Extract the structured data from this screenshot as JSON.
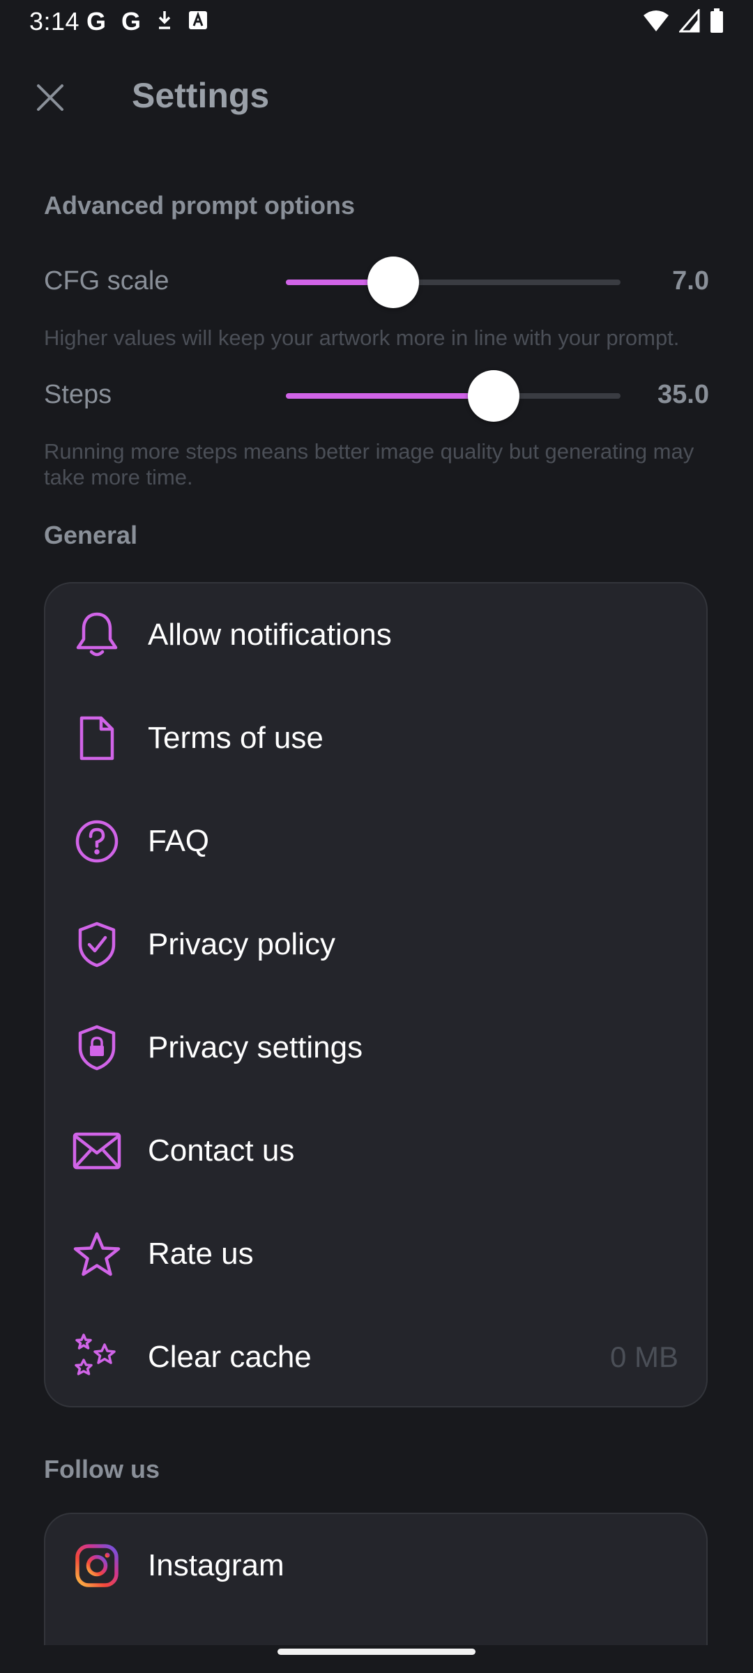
{
  "status_bar": {
    "time": "3:14",
    "left_icons": [
      "google-icon",
      "google-icon",
      "download-icon",
      "a-icon"
    ],
    "right_icons": [
      "wifi-icon",
      "cell-signal-icon",
      "battery-icon"
    ],
    "g_letter": "G"
  },
  "header": {
    "title": "Settings"
  },
  "advanced": {
    "title": "Advanced prompt options",
    "cfg": {
      "label": "CFG scale",
      "value": "7.0",
      "fraction": 0.32,
      "description": "Higher values will keep your artwork more in line with your prompt."
    },
    "steps": {
      "label": "Steps",
      "value": "35.0",
      "fraction": 0.62,
      "description": "Running more steps means better image quality but generating may take more time."
    }
  },
  "general": {
    "title": "General",
    "items": [
      {
        "label": "Allow notifications",
        "icon": "bell-icon"
      },
      {
        "label": "Terms of use",
        "icon": "document-icon"
      },
      {
        "label": "FAQ",
        "icon": "help-circle-icon"
      },
      {
        "label": "Privacy policy",
        "icon": "shield-check-icon"
      },
      {
        "label": "Privacy settings",
        "icon": "shield-lock-icon"
      },
      {
        "label": "Contact us",
        "icon": "mail-icon"
      },
      {
        "label": "Rate us",
        "icon": "star-icon"
      },
      {
        "label": "Clear cache",
        "icon": "sparkle-stars-icon",
        "value": "0 MB"
      }
    ]
  },
  "follow": {
    "title": "Follow us",
    "items": [
      {
        "label": "Instagram",
        "icon": "instagram-icon"
      }
    ]
  },
  "colors": {
    "background": "#18191d",
    "card": "#24252b",
    "accent": "#d164e8",
    "muted_text": "#8a9099"
  }
}
